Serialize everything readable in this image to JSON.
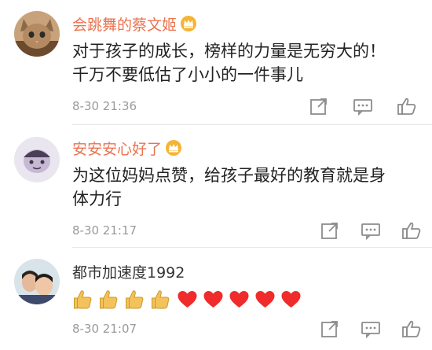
{
  "comments": [
    {
      "username": "会跳舞的蔡文姬",
      "name_color": "#eb7350",
      "badge": "vip-crown-icon",
      "lines": [
        "对于孩子的成长，榜样的力量是无穷大的！",
        "千万不要低估了小小的一件事儿"
      ],
      "timestamp": "8-30 21:36",
      "avatar": "cat-avatar"
    },
    {
      "username": "安安安心好了",
      "name_color": "#eb7350",
      "badge": "vip-crown-icon",
      "lines": [
        "为这位妈妈点赞，给孩子最好的教育就是身",
        "体力行"
      ],
      "timestamp": "8-30 21:17",
      "avatar": "cartoon-avatar"
    },
    {
      "username": "都市加速度1992",
      "name_color": "#333333",
      "emojis": [
        "thumbs-up-emoji",
        "thumbs-up-emoji",
        "thumbs-up-emoji",
        "thumbs-up-emoji",
        "heart-emoji",
        "heart-emoji",
        "heart-emoji",
        "heart-emoji",
        "heart-emoji"
      ],
      "timestamp": "8-30 21:07",
      "avatar": "photo-avatar"
    }
  ],
  "action_icons": [
    "share-icon",
    "reply-icon",
    "like-icon"
  ],
  "colors": {
    "username_accent": "#eb7350",
    "timestamp": "#9a9a9a",
    "heart": "#ef2b2b",
    "thumb": "#f3c25a"
  }
}
